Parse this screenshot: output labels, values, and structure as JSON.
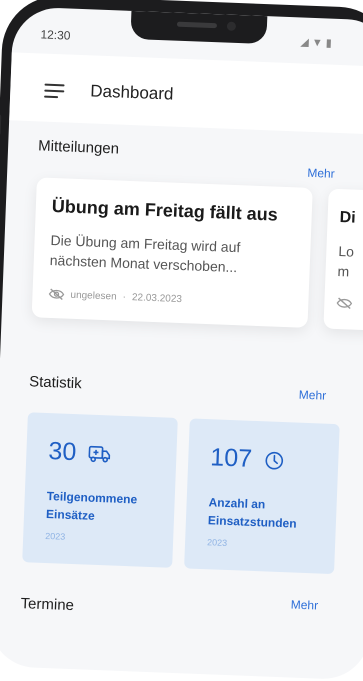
{
  "status_bar": {
    "time": "12:30",
    "icons": "◢▼▮"
  },
  "header": {
    "title": "Dashboard"
  },
  "messages": {
    "title": "Mitteilungen",
    "more_label": "Mehr",
    "cards": [
      {
        "title": "Übung am Freitag fällt aus",
        "body": "Die Übung am Freitag wird auf nächsten Monat verschoben...",
        "status": "ungelesen",
        "separator": "·",
        "date": "22.03.2023"
      },
      {
        "title": "Di",
        "body_line1": "Lo",
        "body_line2": "m"
      }
    ]
  },
  "statistics": {
    "title": "Statistik",
    "more_label": "Mehr",
    "cards": [
      {
        "value": "30",
        "icon": "truck-icon",
        "label": "Teilgenommene Einsätze",
        "year": "2023"
      },
      {
        "value": "107",
        "icon": "clock-icon",
        "label": "Anzahl an Einsatzstunden",
        "year": "2023"
      }
    ]
  },
  "appointments": {
    "title": "Termine",
    "more_label": "Mehr"
  },
  "colors": {
    "accent": "#2e6fd8",
    "stat_bg": "#dde9f7",
    "stat_text": "#1f5fc4",
    "frame": "#1c1c1e"
  }
}
